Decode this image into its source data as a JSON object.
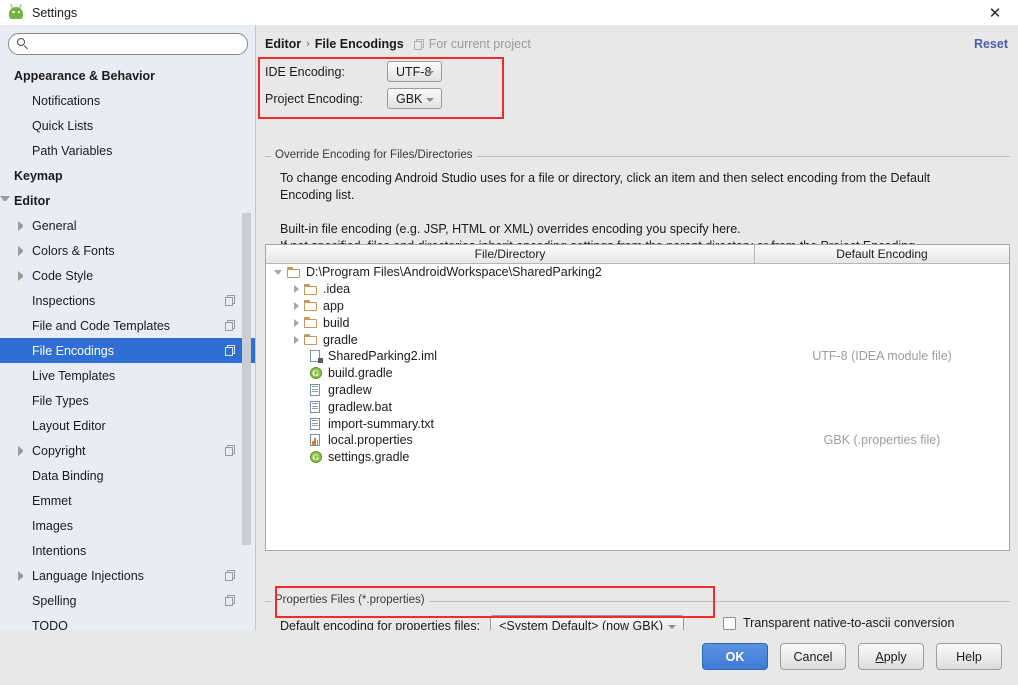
{
  "window": {
    "title": "Settings",
    "app_icon": "android-studio-icon",
    "close_label": "✕"
  },
  "search": {
    "value": "",
    "placeholder": "",
    "icon": "search-icon"
  },
  "sidebar": {
    "items": [
      {
        "label": "Appearance & Behavior",
        "indent": 0,
        "bold": true,
        "arrow": "none",
        "badge": false,
        "selected": false
      },
      {
        "label": "Notifications",
        "indent": 1,
        "bold": false,
        "arrow": "none",
        "badge": false,
        "selected": false
      },
      {
        "label": "Quick Lists",
        "indent": 1,
        "bold": false,
        "arrow": "none",
        "badge": false,
        "selected": false
      },
      {
        "label": "Path Variables",
        "indent": 1,
        "bold": false,
        "arrow": "none",
        "badge": false,
        "selected": false
      },
      {
        "label": "Keymap",
        "indent": 0,
        "bold": true,
        "arrow": "none",
        "badge": false,
        "selected": false
      },
      {
        "label": "Editor",
        "indent": 0,
        "bold": true,
        "arrow": "down",
        "badge": false,
        "selected": false
      },
      {
        "label": "General",
        "indent": 1,
        "bold": false,
        "arrow": "right",
        "badge": false,
        "selected": false
      },
      {
        "label": "Colors & Fonts",
        "indent": 1,
        "bold": false,
        "arrow": "right",
        "badge": false,
        "selected": false
      },
      {
        "label": "Code Style",
        "indent": 1,
        "bold": false,
        "arrow": "right",
        "badge": false,
        "selected": false
      },
      {
        "label": "Inspections",
        "indent": 1,
        "bold": false,
        "arrow": "none",
        "badge": true,
        "selected": false
      },
      {
        "label": "File and Code Templates",
        "indent": 1,
        "bold": false,
        "arrow": "none",
        "badge": true,
        "selected": false
      },
      {
        "label": "File Encodings",
        "indent": 1,
        "bold": false,
        "arrow": "none",
        "badge": true,
        "selected": true
      },
      {
        "label": "Live Templates",
        "indent": 1,
        "bold": false,
        "arrow": "none",
        "badge": false,
        "selected": false
      },
      {
        "label": "File Types",
        "indent": 1,
        "bold": false,
        "arrow": "none",
        "badge": false,
        "selected": false
      },
      {
        "label": "Layout Editor",
        "indent": 1,
        "bold": false,
        "arrow": "none",
        "badge": false,
        "selected": false
      },
      {
        "label": "Copyright",
        "indent": 1,
        "bold": false,
        "arrow": "right",
        "badge": true,
        "selected": false
      },
      {
        "label": "Data Binding",
        "indent": 1,
        "bold": false,
        "arrow": "none",
        "badge": false,
        "selected": false
      },
      {
        "label": "Emmet",
        "indent": 1,
        "bold": false,
        "arrow": "none",
        "badge": false,
        "selected": false
      },
      {
        "label": "Images",
        "indent": 1,
        "bold": false,
        "arrow": "none",
        "badge": false,
        "selected": false
      },
      {
        "label": "Intentions",
        "indent": 1,
        "bold": false,
        "arrow": "none",
        "badge": false,
        "selected": false
      },
      {
        "label": "Language Injections",
        "indent": 1,
        "bold": false,
        "arrow": "right",
        "badge": true,
        "selected": false
      },
      {
        "label": "Spelling",
        "indent": 1,
        "bold": false,
        "arrow": "none",
        "badge": true,
        "selected": false
      },
      {
        "label": "TODO",
        "indent": 1,
        "bold": false,
        "arrow": "none",
        "badge": false,
        "selected": false
      }
    ]
  },
  "header": {
    "breadcrumb_parent": "Editor",
    "breadcrumb_separator": "›",
    "breadcrumb_current": "File Encodings",
    "scope_note": "For current project",
    "scope_icon": "project-scope-icon",
    "reset_label": "Reset"
  },
  "encodings": {
    "ide": {
      "label": "IDE Encoding:",
      "value": "UTF-8"
    },
    "project": {
      "label": "Project Encoding:",
      "value": "GBK"
    }
  },
  "override_group": {
    "title": "Override Encoding for Files/Directories",
    "paragraph1_line1": "To change encoding Android Studio uses for a file or directory, click an item and then select encoding from the Default",
    "paragraph1_line2": "Encoding list.",
    "paragraph2_line1": "Built-in file encoding (e.g. JSP, HTML or XML) overrides encoding you specify here.",
    "paragraph2_line2": "If not specified, files and directories inherit encoding settings from the parent directory or from the Project Encoding."
  },
  "file_table": {
    "columns": [
      "File/Directory",
      "Default Encoding"
    ],
    "rows": [
      {
        "name": "D:\\Program Files\\AndroidWorkspace\\SharedParking2",
        "indent": 0,
        "arrow": "down",
        "icon": "folder-icon",
        "encoding": ""
      },
      {
        "name": ".idea",
        "indent": 1,
        "arrow": "right",
        "icon": "folder-icon",
        "encoding": ""
      },
      {
        "name": "app",
        "indent": 1,
        "arrow": "right",
        "icon": "folder-icon",
        "encoding": ""
      },
      {
        "name": "build",
        "indent": 1,
        "arrow": "right",
        "icon": "folder-icon",
        "encoding": ""
      },
      {
        "name": "gradle",
        "indent": 1,
        "arrow": "right",
        "icon": "folder-icon",
        "encoding": ""
      },
      {
        "name": "SharedParking2.iml",
        "indent": 1,
        "arrow": "none",
        "icon": "iml-file-icon",
        "encoding": "UTF-8 (IDEA module file)"
      },
      {
        "name": "build.gradle",
        "indent": 1,
        "arrow": "none",
        "icon": "gradle-file-icon",
        "encoding": ""
      },
      {
        "name": "gradlew",
        "indent": 1,
        "arrow": "none",
        "icon": "text-file-icon",
        "encoding": ""
      },
      {
        "name": "gradlew.bat",
        "indent": 1,
        "arrow": "none",
        "icon": "text-file-icon",
        "encoding": ""
      },
      {
        "name": "import-summary.txt",
        "indent": 1,
        "arrow": "none",
        "icon": "text-file-icon",
        "encoding": ""
      },
      {
        "name": "local.properties",
        "indent": 1,
        "arrow": "none",
        "icon": "properties-file-icon",
        "encoding": "GBK (.properties file)"
      },
      {
        "name": "settings.gradle",
        "indent": 1,
        "arrow": "none",
        "icon": "gradle-file-icon",
        "encoding": ""
      }
    ],
    "gradle_glyph": "G"
  },
  "properties_group": {
    "title": "Properties Files (*.properties)",
    "default_encoding_label": "Default encoding for properties files:",
    "default_encoding_value": "<System Default> (now GBK)",
    "transparent_label": "Transparent native-to-ascii conversion",
    "transparent_checked": false
  },
  "footer": {
    "ok": "OK",
    "cancel": "Cancel",
    "apply_underlined": "A",
    "apply_rest": "pply",
    "help": "Help"
  },
  "colors": {
    "selection_blue": "#2f6fd4",
    "highlight_red": "#ef2b2b",
    "link_blue": "#4a5fa8",
    "sidebar_bg": "#e9ecf5",
    "panel_bg": "#e8e8e8",
    "muted_text": "#9d9d9d"
  }
}
